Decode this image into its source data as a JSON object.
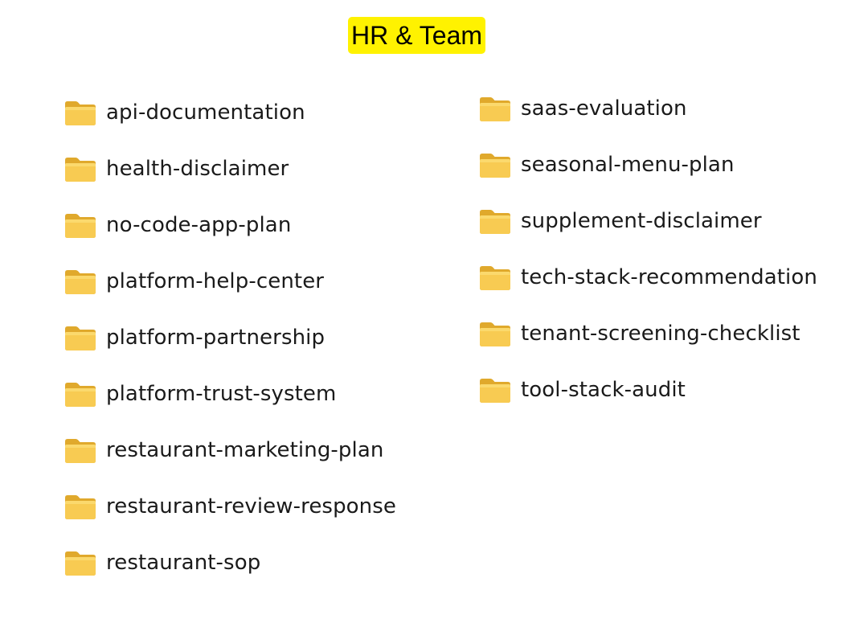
{
  "header": {
    "title": "HR & Team",
    "highlight_color": "#fff200"
  },
  "folder_icon": "folder-icon",
  "folder_color": "#f5c542",
  "columns": [
    {
      "items": [
        {
          "label": "api-documentation"
        },
        {
          "label": "health-disclaimer"
        },
        {
          "label": "no-code-app-plan"
        },
        {
          "label": "platform-help-center"
        },
        {
          "label": "platform-partnership"
        },
        {
          "label": "platform-trust-system"
        },
        {
          "label": "restaurant-marketing-plan"
        },
        {
          "label": "restaurant-review-response"
        },
        {
          "label": "restaurant-sop"
        }
      ]
    },
    {
      "items": [
        {
          "label": "saas-evaluation"
        },
        {
          "label": "seasonal-menu-plan"
        },
        {
          "label": "supplement-disclaimer"
        },
        {
          "label": "tech-stack-recommendation"
        },
        {
          "label": "tenant-screening-checklist"
        },
        {
          "label": "tool-stack-audit"
        }
      ]
    }
  ]
}
